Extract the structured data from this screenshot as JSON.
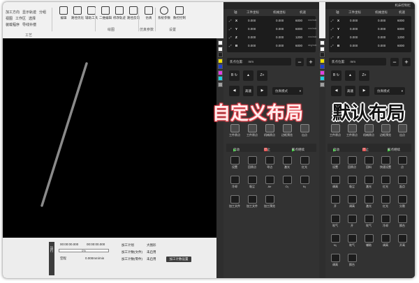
{
  "captions": {
    "custom": "自定义布局",
    "default": "默认布局"
  },
  "ribbon": {
    "left_rows": [
      [
        "加工方向",
        "显示轨迹",
        "分组"
      ],
      [
        "视图",
        "工作区",
        "选择"
      ],
      [
        "装载程序",
        "导线补偿"
      ]
    ],
    "left_group": "工艺",
    "buttons": [
      {
        "label": "编辑",
        "icon": "edit-icon"
      },
      {
        "label": "路径优化",
        "icon": "path-icon"
      },
      {
        "label": "辅助工具",
        "icon": "tool-icon"
      },
      {
        "label": "二维编辑",
        "icon": "pencil-icon"
      },
      {
        "label": "修改轨迹",
        "icon": "brush-icon"
      },
      {
        "label": "路径反向",
        "icon": "reverse-icon"
      },
      {
        "label": "仿真",
        "icon": "grid-icon"
      },
      {
        "label": "系统参数",
        "icon": "gear-icon"
      },
      {
        "label": "数控控制",
        "icon": "control-icon"
      }
    ],
    "groups": [
      "绘图",
      "仿真参数",
      "设置"
    ]
  },
  "palette_colors": [
    "#ffffff",
    "#ffffff",
    "#202020",
    "#f0e000",
    "#1e3fd0",
    "#e040e0",
    "#20d0e0",
    "#a0a0a0"
  ],
  "panel_title": "机床控制栏",
  "coords": {
    "headers": [
      "轴",
      "工件坐标",
      "机械坐标",
      "机速"
    ],
    "rows": [
      {
        "axis": "X",
        "work": "0.000",
        "mach": "0.000",
        "speed": "6000",
        "unit": "mm/min"
      },
      {
        "axis": "Y",
        "work": "0.000",
        "mach": "0.000",
        "speed": "6000",
        "unit": "mm/min"
      },
      {
        "axis": "Z",
        "work": "0.000",
        "mach": "0.000",
        "speed": "1200",
        "unit": "mm/min"
      },
      {
        "axis": "B",
        "work": "0.000",
        "mach": "0.000",
        "speed": "6000",
        "unit": "deg/min"
      }
    ]
  },
  "jog": {
    "point_label": "焦点位置:",
    "point_value": "mm",
    "minus": "−",
    "plus": "+",
    "b_minus": "B ↻",
    "z_plus": "Z+",
    "z_minus": "Z-",
    "high_speed": "高速",
    "mode_label": "仿真模式",
    "arrow_up": "▲",
    "arrow_down": "▼",
    "arrow_left": "◀",
    "arrow_right": "▶"
  },
  "tools_row1": [
    "工件原点",
    "工件原点",
    "机械原点",
    "边框预览",
    "出点"
  ],
  "control": {
    "start": "启动",
    "stop": "停止",
    "breakpoint": "断点继续"
  },
  "tiles_left": [
    [
      "设置",
      "回原点",
      "寻边",
      "激光",
      "红光"
    ],
    [
      "冷却",
      "吸尘",
      "Air",
      "O₂",
      "N₂"
    ],
    [
      "加工文件",
      "加工文件",
      "加工预览"
    ]
  ],
  "tiles_right": [
    [
      "设置",
      "回原点",
      "回料",
      "快速设置",
      "点"
    ],
    [
      "调高",
      "吸尘",
      "激光",
      "红光",
      "起点"
    ],
    [
      "开",
      "调高",
      "激光",
      "红光",
      "分割"
    ],
    [
      "吹气",
      "开",
      "吹气",
      "冷却",
      "换台"
    ],
    [
      "N₂",
      "吹气",
      "辅助",
      "调高",
      "开高"
    ],
    [
      "调高",
      "换台"
    ]
  ],
  "bottom": {
    "vertical": "运行",
    "time1": "00:00:00.000",
    "time2": "00:00:00.000",
    "progress_text": "0%",
    "length_label": "空程",
    "speed_text": "0.000mm/min",
    "right_labels": [
      "加工计划",
      "大图形",
      "加工计数(文件)",
      "未启用",
      "加工计数(零件)",
      "未启用"
    ],
    "settings_button": "加工计数设置"
  }
}
